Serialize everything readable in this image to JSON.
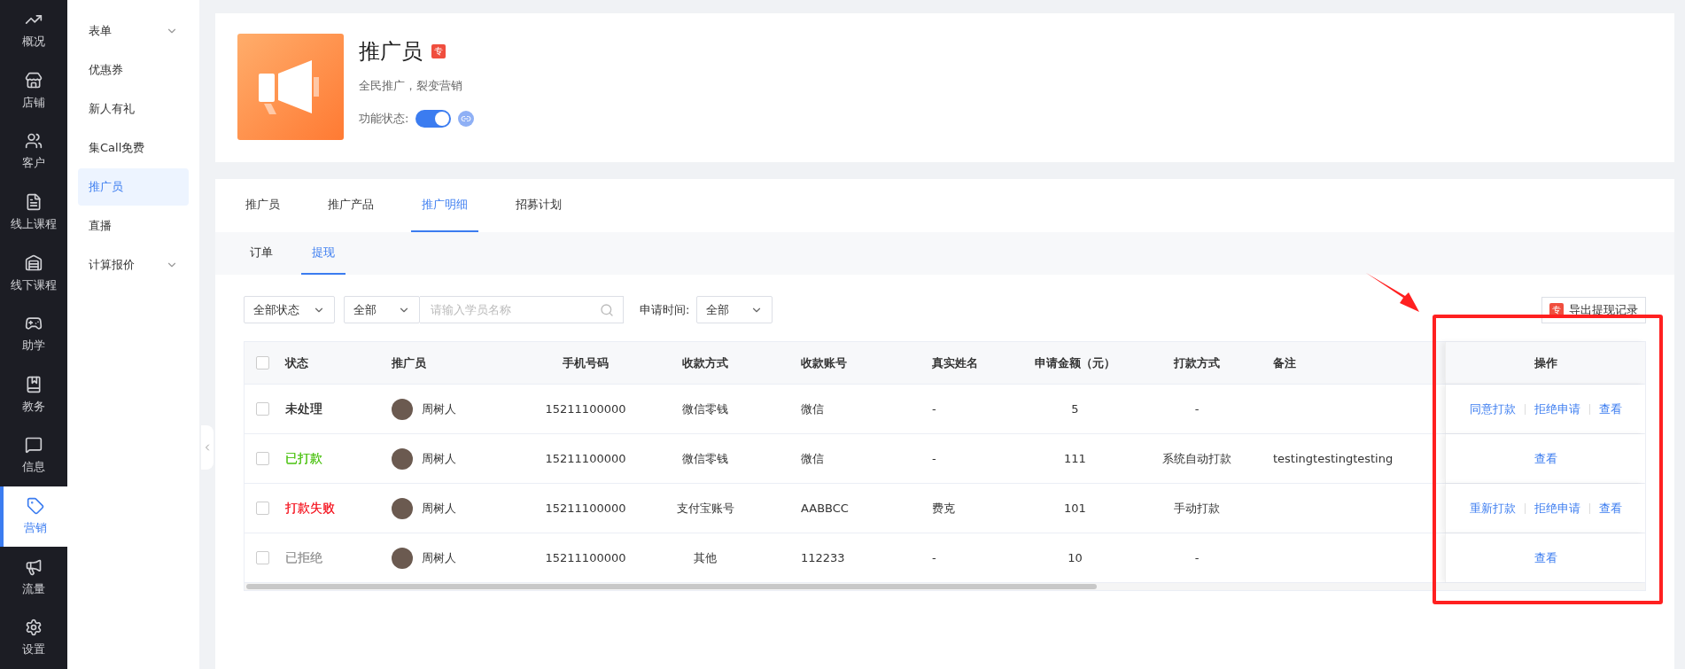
{
  "main_nav": [
    {
      "label": "概况",
      "selected": false
    },
    {
      "label": "店铺",
      "selected": false
    },
    {
      "label": "客户",
      "selected": false
    },
    {
      "label": "线上课程",
      "selected": false
    },
    {
      "label": "线下课程",
      "selected": false
    },
    {
      "label": "助学",
      "selected": false
    },
    {
      "label": "教务",
      "selected": false
    },
    {
      "label": "信息",
      "selected": false
    },
    {
      "label": "营销",
      "selected": true
    },
    {
      "label": "流量",
      "selected": false
    },
    {
      "label": "设置",
      "selected": false
    }
  ],
  "sub_nav": [
    {
      "label": "表单",
      "kind": "group",
      "selected": false
    },
    {
      "label": "优惠券",
      "kind": "link",
      "selected": false
    },
    {
      "label": "新人有礼",
      "kind": "link",
      "selected": false
    },
    {
      "label": "集Call免费",
      "kind": "link",
      "selected": false
    },
    {
      "label": "推广员",
      "kind": "link",
      "selected": true
    },
    {
      "label": "直播",
      "kind": "link",
      "selected": false
    },
    {
      "label": "计算报价",
      "kind": "group",
      "selected": false
    }
  ],
  "app_header": {
    "title": "推广员",
    "badge": "专",
    "subtitle": "全民推广，裂变营销",
    "status_label": "功能状态:",
    "status_on": true
  },
  "tabs": [
    {
      "label": "推广员",
      "selected": false
    },
    {
      "label": "推广产品",
      "selected": false
    },
    {
      "label": "推广明细",
      "selected": true
    },
    {
      "label": "招募计划",
      "selected": false
    }
  ],
  "sub_tabs": [
    {
      "label": "订单",
      "selected": false
    },
    {
      "label": "提现",
      "selected": true
    }
  ],
  "filters": {
    "status_select": "全部状态",
    "scope_select": "全部",
    "search": {
      "placeholder": "请输入学员名称"
    },
    "time_label": "申请时间:",
    "time_select": "全部"
  },
  "export_button": {
    "badge": "专",
    "label": "导出提现记录"
  },
  "table": {
    "all_checked": false,
    "columns": [
      "状态",
      "推广员",
      "手机号码",
      "收款方式",
      "收款账号",
      "真实姓名",
      "申请金额（元）",
      "打款方式",
      "备注",
      "操作"
    ],
    "rows": [
      {
        "checked": false,
        "status": "未处理",
        "color": "#333333",
        "promoter": "周树人",
        "phone": "15211100000",
        "method": "微信零钱",
        "account": "微信",
        "real_name": "-",
        "amount": "5",
        "pay_mode": "-",
        "remark": "",
        "actions": [
          "同意打款",
          "拒绝申请",
          "查看"
        ]
      },
      {
        "checked": false,
        "status": "已打款",
        "color": "#52c41a",
        "promoter": "周树人",
        "phone": "15211100000",
        "method": "微信零钱",
        "account": "微信",
        "real_name": "-",
        "amount": "111",
        "pay_mode": "系统自动打款",
        "remark": "testingtestingtesting",
        "actions": [
          "查看"
        ]
      },
      {
        "checked": false,
        "status": "打款失败",
        "color": "#f5222d",
        "promoter": "周树人",
        "phone": "15211100000",
        "method": "支付宝账号",
        "account": "AABBCC",
        "real_name": "费克",
        "amount": "101",
        "pay_mode": "手动打款",
        "remark": "",
        "actions": [
          "重新打款",
          "拒绝申请",
          "查看"
        ]
      },
      {
        "checked": false,
        "status": "已拒绝",
        "color": "#999999",
        "promoter": "周树人",
        "phone": "15211100000",
        "method": "其他",
        "account": "112233",
        "real_name": "-",
        "amount": "10",
        "pay_mode": "-",
        "remark": "",
        "actions": [
          "查看"
        ]
      }
    ]
  }
}
